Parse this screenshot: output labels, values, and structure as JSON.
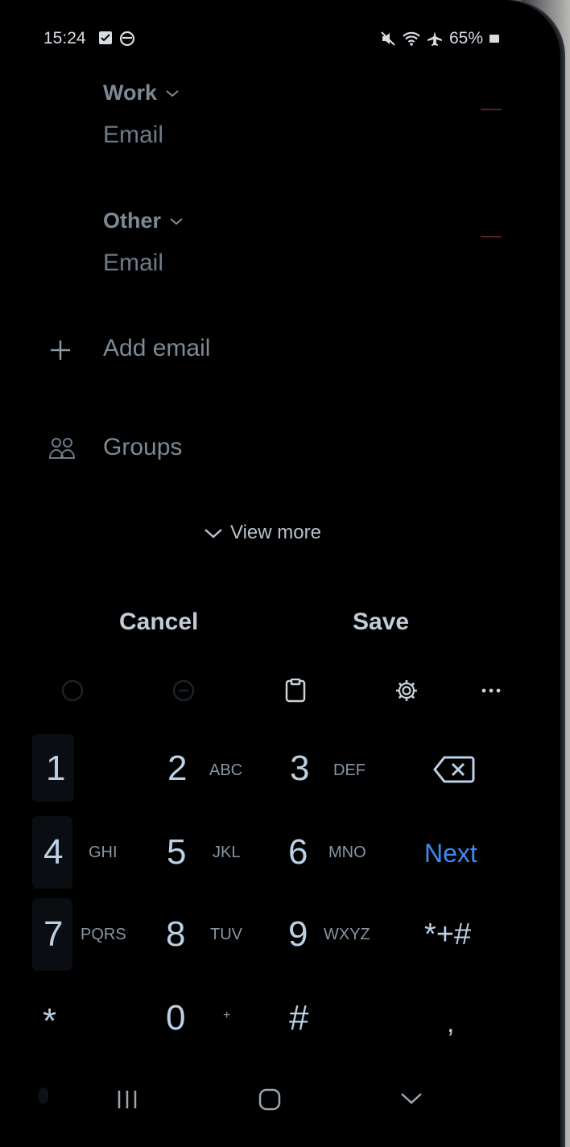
{
  "status": {
    "time": "15:24",
    "battery": "65%"
  },
  "fields": [
    {
      "type_label": "Work",
      "value_placeholder": "Email"
    },
    {
      "type_label": "Other",
      "value_placeholder": "Email"
    }
  ],
  "add_email": "Add email",
  "groups": "Groups",
  "view_more": "View more",
  "actions": {
    "cancel": "Cancel",
    "save": "Save"
  },
  "keyboard": {
    "keys": [
      {
        "num": "1",
        "letters": ""
      },
      {
        "num": "2",
        "letters": "ABC"
      },
      {
        "num": "3",
        "letters": "DEF"
      },
      {
        "num": "4",
        "letters": "GHI"
      },
      {
        "num": "5",
        "letters": "JKL"
      },
      {
        "num": "6",
        "letters": "MNO"
      },
      {
        "num": "7",
        "letters": "PQRS"
      },
      {
        "num": "8",
        "letters": "TUV"
      },
      {
        "num": "9",
        "letters": "WXYZ"
      },
      {
        "num": "*",
        "letters": ""
      },
      {
        "num": "0",
        "letters": "+"
      },
      {
        "num": "#",
        "letters": ""
      }
    ],
    "next": "Next",
    "symbols": "*+#",
    "comma": ","
  },
  "colors": {
    "accent": "#3d8bf0",
    "background": "#000000"
  }
}
